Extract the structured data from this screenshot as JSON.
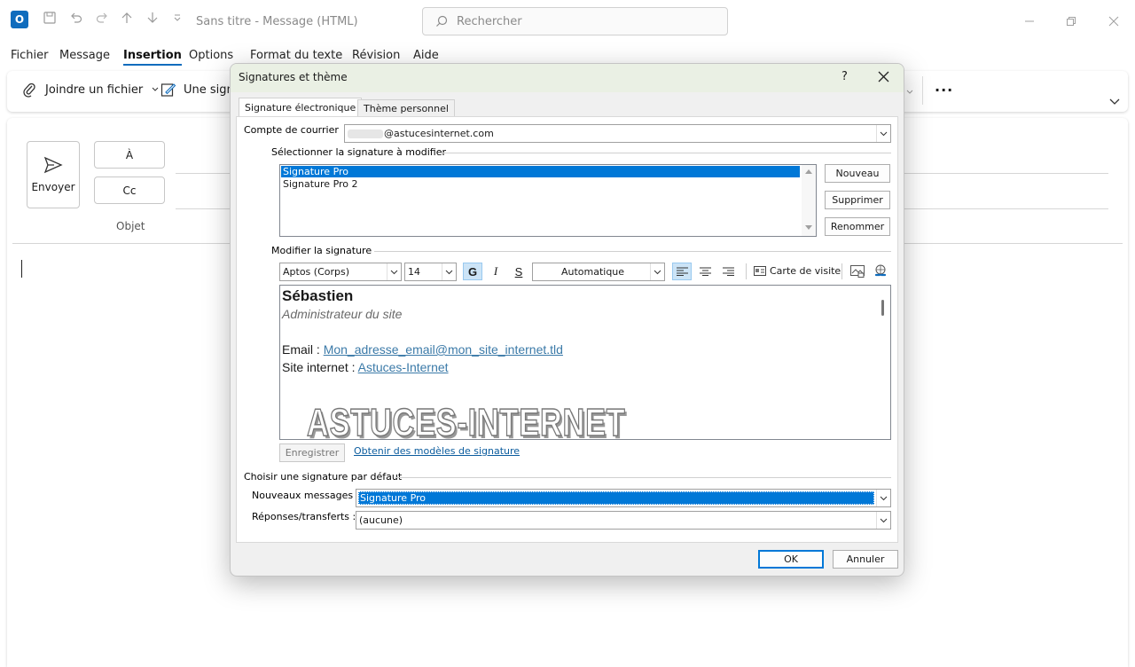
{
  "window": {
    "title": "Sans titre  -  Message (HTML)",
    "search_placeholder": "Rechercher"
  },
  "menu": [
    "Fichier",
    "Message",
    "Insertion",
    "Options",
    "Format du texte",
    "Révision",
    "Aide"
  ],
  "ribbon": {
    "attach_label": "Joindre un fichier",
    "signature_label": "Une sign"
  },
  "compose": {
    "send_label": "Envoyer",
    "to_label": "À",
    "cc_label": "Cc",
    "subject_label": "Objet"
  },
  "dialog": {
    "title": "Signatures et thème",
    "help": "?",
    "tabs": [
      "Signature électronique",
      "Thème personnel"
    ],
    "account_label": "Compte de courrier",
    "account_value": "@astucesinternet.com",
    "select_group": "Sélectionner la signature à modifier",
    "signatures": [
      "Signature Pro",
      "Signature Pro 2"
    ],
    "new_btn": "Nouveau",
    "delete_btn": "Supprimer",
    "rename_btn": "Renommer",
    "edit_group": "Modifier la signature",
    "font": "Aptos (Corps)",
    "size": "14",
    "bold": "G",
    "italic": "I",
    "underline": "S",
    "color": "Automatique",
    "business_card": "Carte de visite",
    "sig_name": "Sébastien",
    "sig_role": "Administrateur du site",
    "sig_email_label": "Email : ",
    "sig_email": "Mon_adresse_email@mon_site_internet.tld",
    "sig_site_label": "Site internet : ",
    "sig_site": "Astuces-Internet",
    "sig_logo": "ASTUCES-INTERNET",
    "save_btn": "Enregistrer",
    "templates_link": "Obtenir des modèles de signature",
    "default_group": "Choisir une signature par défaut",
    "new_msgs_label": "Nouveaux messages :",
    "new_msgs_value": "Signature Pro",
    "replies_label": "Réponses/transferts :",
    "replies_value": "(aucune)",
    "ok_btn": "OK",
    "cancel_btn": "Annuler"
  },
  "colors": {
    "accent": "#0f6cbd",
    "selection": "#0078d7",
    "link": "#3b7aa8"
  }
}
